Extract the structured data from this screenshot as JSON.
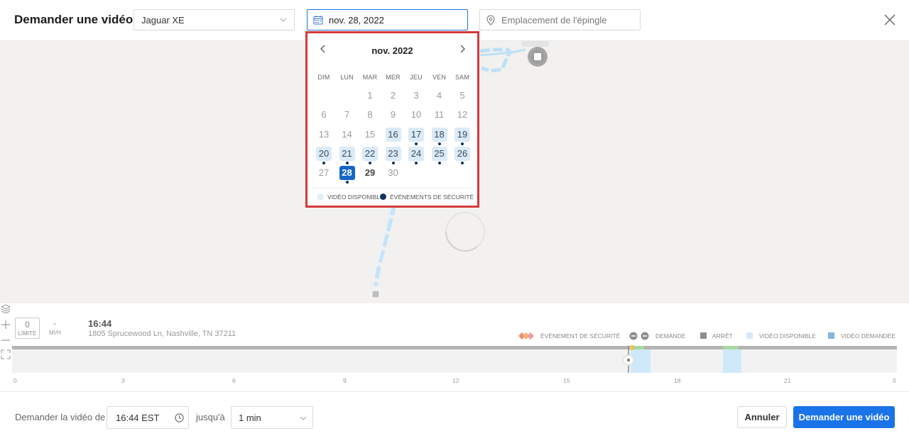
{
  "header": {
    "title": "Demander une vidéo",
    "vehicle": "Jaguar XE",
    "date": "nov. 28, 2022",
    "pin_placeholder": "Emplacement de l'épingle"
  },
  "calendar": {
    "month_label": "nov. 2022",
    "weekdays": [
      "DIM",
      "LUN",
      "MAR",
      "MER",
      "JEU",
      "VEN",
      "SAM"
    ],
    "days": [
      {
        "n": "1",
        "state": "disabled",
        "dot": false
      },
      {
        "n": "2",
        "state": "disabled",
        "dot": false
      },
      {
        "n": "3",
        "state": "disabled",
        "dot": false
      },
      {
        "n": "4",
        "state": "disabled",
        "dot": false
      },
      {
        "n": "5",
        "state": "disabled",
        "dot": false
      },
      {
        "n": "6",
        "state": "disabled",
        "dot": false
      },
      {
        "n": "7",
        "state": "disabled",
        "dot": false
      },
      {
        "n": "8",
        "state": "disabled",
        "dot": false
      },
      {
        "n": "9",
        "state": "disabled",
        "dot": false
      },
      {
        "n": "10",
        "state": "disabled",
        "dot": false
      },
      {
        "n": "11",
        "state": "disabled",
        "dot": false
      },
      {
        "n": "12",
        "state": "disabled",
        "dot": false
      },
      {
        "n": "13",
        "state": "disabled",
        "dot": false
      },
      {
        "n": "14",
        "state": "disabled",
        "dot": false
      },
      {
        "n": "15",
        "state": "disabled",
        "dot": false
      },
      {
        "n": "16",
        "state": "available",
        "dot": false
      },
      {
        "n": "17",
        "state": "available",
        "dot": true
      },
      {
        "n": "18",
        "state": "available",
        "dot": true
      },
      {
        "n": "19",
        "state": "available",
        "dot": true
      },
      {
        "n": "20",
        "state": "available",
        "dot": true
      },
      {
        "n": "21",
        "state": "available",
        "dot": true
      },
      {
        "n": "22",
        "state": "available",
        "dot": true
      },
      {
        "n": "23",
        "state": "available",
        "dot": true
      },
      {
        "n": "24",
        "state": "available",
        "dot": true
      },
      {
        "n": "25",
        "state": "available",
        "dot": true
      },
      {
        "n": "26",
        "state": "available",
        "dot": true
      },
      {
        "n": "27",
        "state": "disabled",
        "dot": false
      },
      {
        "n": "28",
        "state": "selected",
        "dot": true
      },
      {
        "n": "29",
        "state": "bold",
        "dot": false
      },
      {
        "n": "30",
        "state": "disabled",
        "dot": false
      }
    ],
    "legend_available": "VIDÉO DISPONIBLE",
    "legend_safety": "ÉVÉNEMENTS DE SÉCURITÉ"
  },
  "timeline": {
    "speed_limit_value": "0",
    "speed_limit_label": "LIMITE",
    "speed_value": "-",
    "speed_unit": "MI/H",
    "time": "16:44",
    "address": "1805 Sprucewood Ln, Nashville, TN 37211",
    "legend": {
      "safety": "ÉVÉNEMENT DE SÉCURITÉ",
      "request": "DEMANDE",
      "stop": "ARRÊT",
      "available": "VIDÉO DISPONIBLE",
      "requested": "VIDÉO DEMANDÉE"
    },
    "ticks": [
      "0",
      "3",
      "6",
      "9",
      "12",
      "15",
      "18",
      "21",
      "0"
    ]
  },
  "footer": {
    "request_label": "Demander la vidéo de",
    "start_time": "16:44 EST",
    "until_label": "jusqu'à",
    "duration": "1 min",
    "cancel_label": "Annuler",
    "submit_label": "Demander une vidéo"
  },
  "colors": {
    "primary": "#1a73e8",
    "selected_day": "#1466c7",
    "available_day": "#dbeaf7",
    "safety_dot": "#13335e",
    "highlight_border": "#d43a3a",
    "route": "#bfe0f7"
  }
}
